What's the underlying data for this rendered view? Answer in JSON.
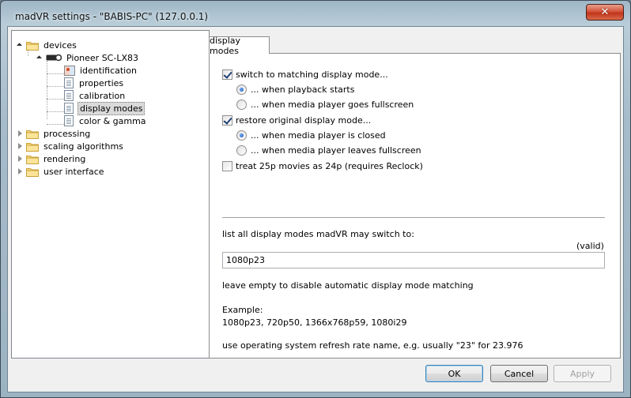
{
  "window": {
    "title": "madVR settings - \"BABIS-PC\" (127.0.0.1)",
    "close_glyph": "✕"
  },
  "tree": {
    "devices": "devices",
    "device_name": "Pioneer SC-LX83",
    "device_children": [
      "identification",
      "properties",
      "calibration",
      "display modes",
      "color & gamma"
    ],
    "selected": "display modes",
    "top_items": [
      "processing",
      "scaling algorithms",
      "rendering",
      "user interface"
    ]
  },
  "tab": {
    "label": "display modes"
  },
  "options": {
    "switch_matching": "switch to matching display mode...",
    "when_playback_starts": "... when playback starts",
    "when_fullscreen": "... when media player goes fullscreen",
    "restore_original": "restore original display mode...",
    "when_closed": "... when media player is closed",
    "when_leaves_fullscreen": "... when media player leaves fullscreen",
    "treat_25p": "treat 25p movies as 24p  (requires Reclock)"
  },
  "state": {
    "switch_matching": true,
    "switch_when": "playback_starts",
    "restore_original": true,
    "restore_when": "closed",
    "treat_25p": false
  },
  "modes": {
    "list_label": "list all display modes madVR may switch to:",
    "valid": "(valid)",
    "value": "1080p23",
    "hint_empty": "leave empty to disable automatic display mode matching",
    "example_label": "Example:",
    "example_value": "1080p23, 720p50, 1366x768p59, 1080i29",
    "hint_refresh": "use operating system refresh rate name, e.g. usually \"23\" for 23.976"
  },
  "buttons": {
    "ok": "OK",
    "cancel": "Cancel",
    "apply": "Apply"
  },
  "icons": {
    "folder": "folder-icon",
    "page": "page-icon",
    "device": "device-icon",
    "identification": "identification-icon"
  }
}
